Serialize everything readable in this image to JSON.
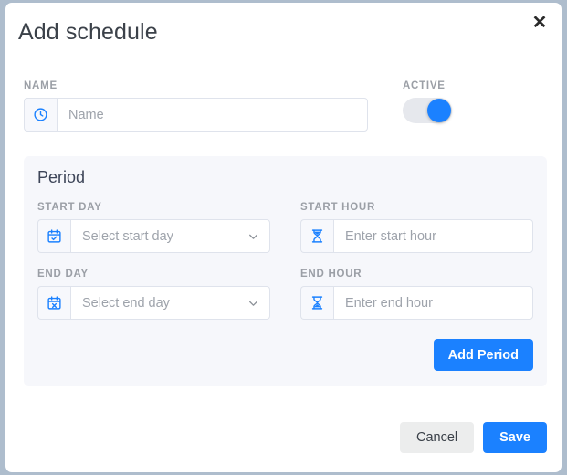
{
  "dialog": {
    "title": "Add schedule",
    "close_icon": "close-icon"
  },
  "name_field": {
    "label": "NAME",
    "placeholder": "Name",
    "value": "",
    "icon": "clock-icon"
  },
  "active_field": {
    "label": "ACTIVE",
    "state": "on"
  },
  "period": {
    "title": "Period",
    "add_button_label": "Add Period",
    "fields": [
      {
        "label": "START DAY",
        "placeholder": "Select start day",
        "value": "",
        "icon": "calendar-check-icon",
        "type": "select"
      },
      {
        "label": "START HOUR",
        "placeholder": "Enter start hour",
        "value": "",
        "icon": "hourglass-full-icon",
        "type": "input"
      },
      {
        "label": "END DAY",
        "placeholder": "Select end day",
        "value": "",
        "icon": "calendar-x-icon",
        "type": "select"
      },
      {
        "label": "END HOUR",
        "placeholder": "Enter end hour",
        "value": "",
        "icon": "hourglass-empty-icon",
        "type": "input"
      }
    ]
  },
  "footer": {
    "cancel_label": "Cancel",
    "save_label": "Save"
  },
  "colors": {
    "accent": "#1b81ff",
    "panel_bg": "#f6f7fb",
    "page_bg": "#aebdcd",
    "label_text": "#9b9fa6"
  }
}
